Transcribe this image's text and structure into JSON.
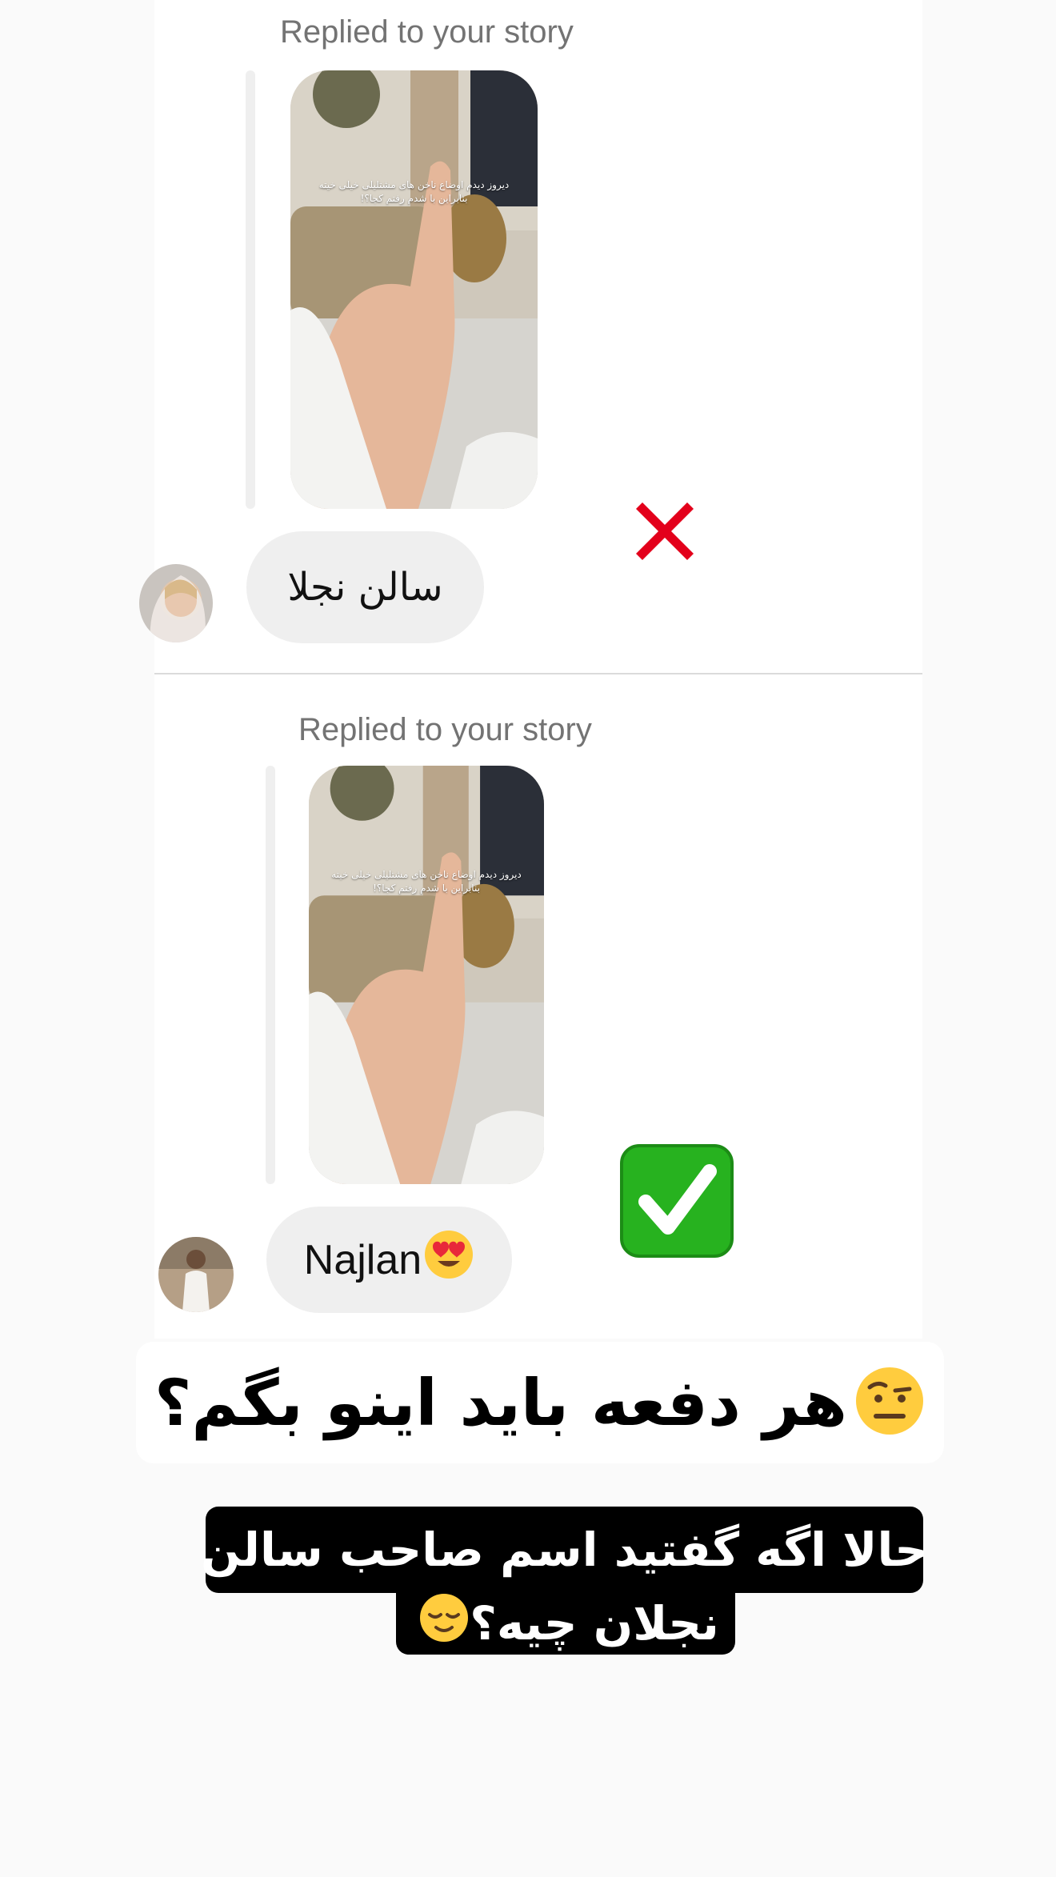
{
  "conversation": {
    "first": {
      "reply_label": "Replied to your story",
      "story_caption": "دیروز دیدم اوضاع ناخن های مشتلیلی خیلی خیته بنابراین با شدم رفتم کجا؟!",
      "message": "سالن نجلا",
      "verdict_icon": "cross-mark-icon",
      "verdict_color": "#e3001b"
    },
    "second": {
      "reply_label": "Replied to your story",
      "story_caption": "دیروز دیدم اوضاع ناخن های مشتلیلی خیلی خیته بنابراین با شدم رفتم کجا؟!",
      "message": "Najlan",
      "message_emoji_icon": "heart-eyes-emoji-icon",
      "verdict_icon": "check-mark-button-icon",
      "verdict_color": "#27b21f"
    }
  },
  "caption": {
    "text": "هر دفعه باید اینو بگم؟",
    "emoji_icon": "raised-eyebrow-emoji-icon"
  },
  "highlight": {
    "line1": "حالا اگه گفتید اسم صاحب سالن",
    "line2": "نجلان چیه؟",
    "emoji_icon": "relieved-face-emoji-icon"
  }
}
